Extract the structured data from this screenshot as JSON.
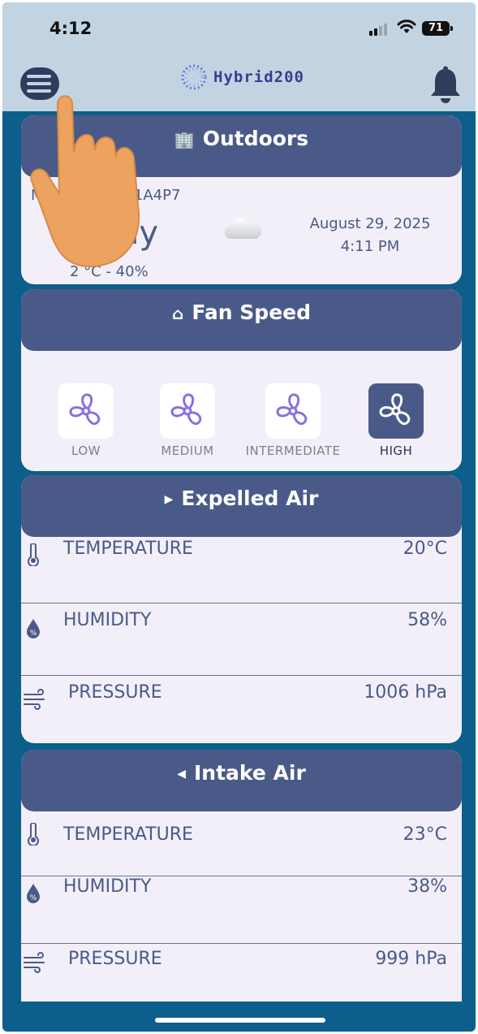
{
  "status_bar": {
    "time": "4:12",
    "battery": "71"
  },
  "app_bar": {
    "logo_text": "Hybrid200"
  },
  "outdoors": {
    "title": "Outdoors",
    "device_fragment": "M",
    "device_suffix": "E1A4P7",
    "condition": "dy",
    "temp_range": "2 °C - 40%",
    "date": "August 29, 2025",
    "time": "4:11 PM"
  },
  "fan_speed": {
    "title": "Fan Speed",
    "options": [
      {
        "label": "LOW",
        "selected": false
      },
      {
        "label": "MEDIUM",
        "selected": false
      },
      {
        "label": "INTERMEDIATE",
        "selected": false
      },
      {
        "label": "HIGH",
        "selected": true
      }
    ]
  },
  "expelled_air": {
    "title": "Expelled Air",
    "rows": [
      {
        "icon": "thermometer-icon",
        "label": "TEMPERATURE",
        "value": "20°C"
      },
      {
        "icon": "humidity-drop-icon",
        "label": "HUMIDITY",
        "value": "58%"
      },
      {
        "icon": "wind-icon",
        "label": "PRESSURE",
        "value": "1006 hPa"
      }
    ]
  },
  "intake_air": {
    "title": "Intake Air",
    "rows": [
      {
        "icon": "thermometer-icon",
        "label": "TEMPERATURE",
        "value": "23°C"
      },
      {
        "icon": "humidity-drop-icon",
        "label": "HUMIDITY",
        "value": "38%"
      },
      {
        "icon": "wind-icon",
        "label": "PRESSURE",
        "value": "999 hPa"
      }
    ]
  },
  "colors": {
    "background": "#0b5f8a",
    "header": "#c2d4e2",
    "card": "#f3eff8",
    "card_header": "#4a5a88",
    "accent": "#3b3d8f"
  }
}
